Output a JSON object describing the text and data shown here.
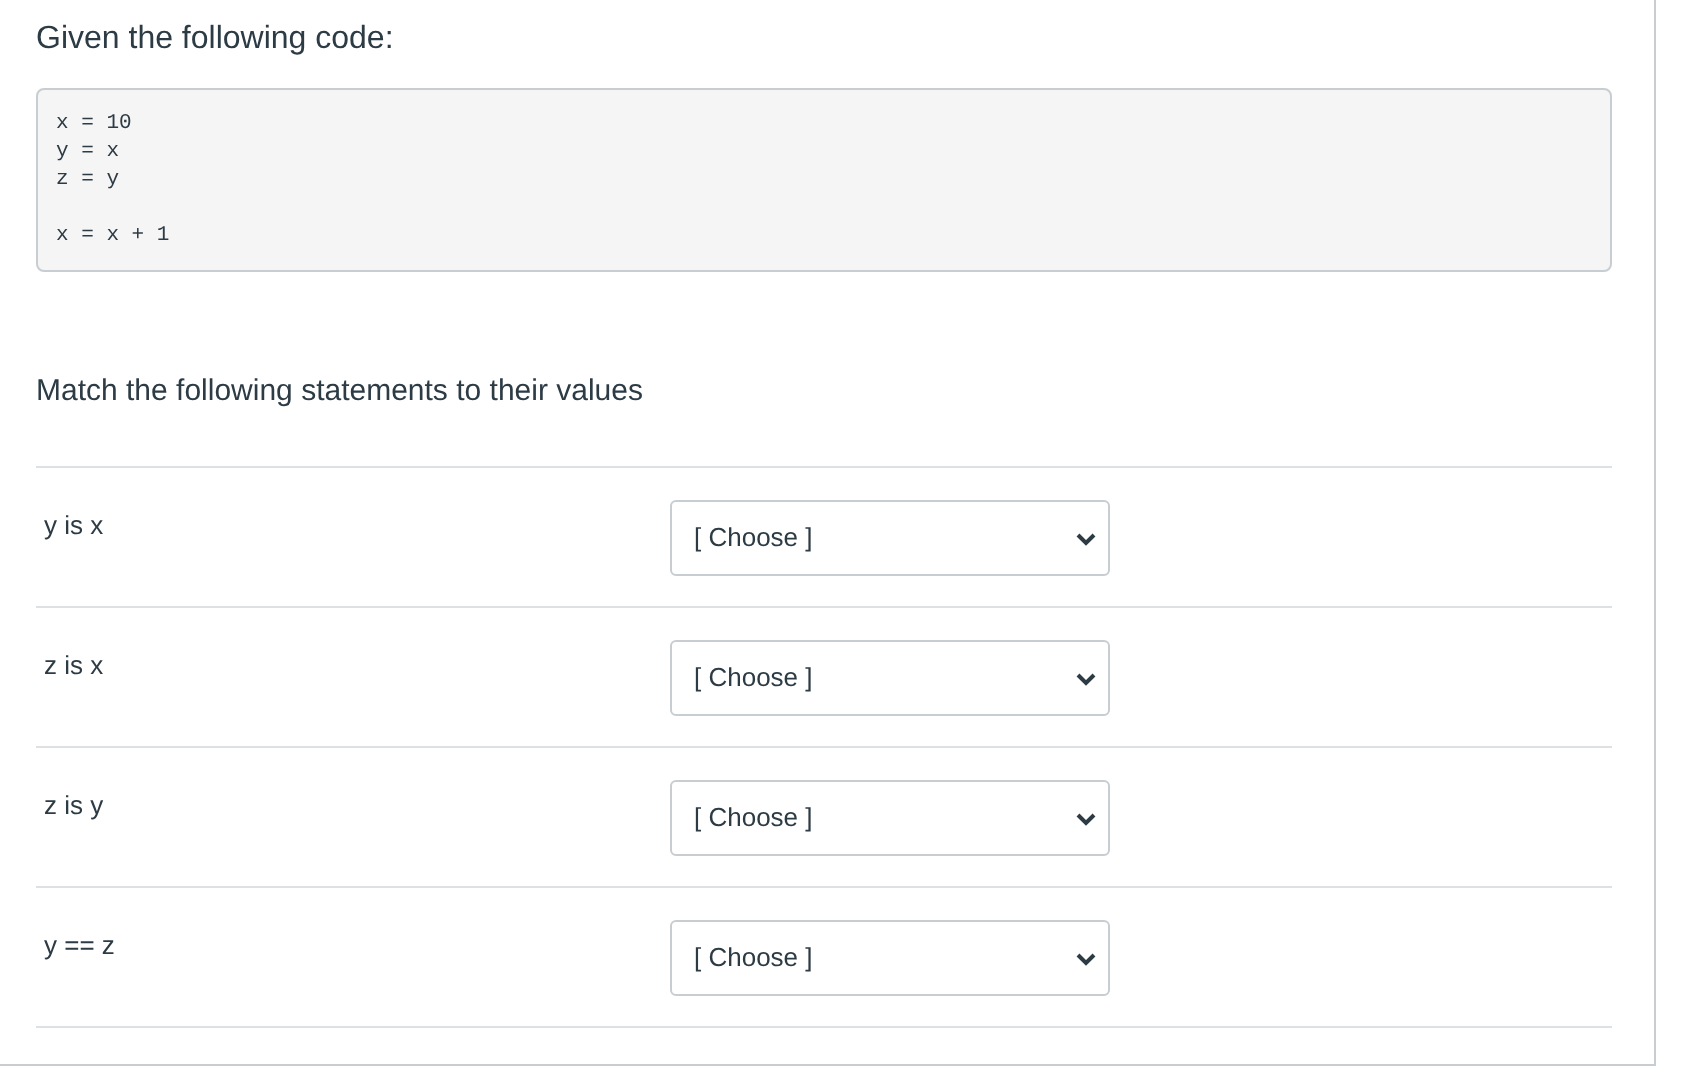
{
  "question": {
    "intro": "Given the following code:",
    "code": "x = 10\ny = x\nz = y\n\nx = x + 1",
    "prompt": "Match the following statements to their values",
    "matches": [
      {
        "statement": "y is x",
        "answer": "[ Choose ]"
      },
      {
        "statement": "z is x",
        "answer": "[ Choose ]"
      },
      {
        "statement": "z is y",
        "answer": "[ Choose ]"
      },
      {
        "statement": "y == z",
        "answer": "[ Choose ]"
      }
    ]
  }
}
